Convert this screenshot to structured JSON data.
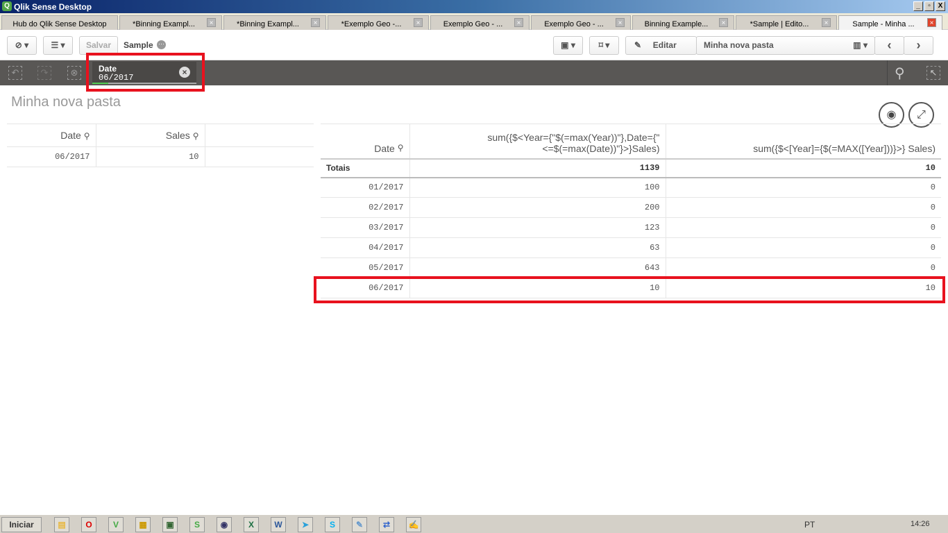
{
  "window": {
    "title": "Qlik Sense Desktop",
    "minimize": "_",
    "restore": "▫",
    "close": "X"
  },
  "tabs": [
    {
      "label": "Hub do Qlik Sense Desktop",
      "closable": false
    },
    {
      "label": "*Binning Exampl...",
      "closable": true
    },
    {
      "label": "*Binning Exampl...",
      "closable": true
    },
    {
      "label": "*Exemplo Geo -...",
      "closable": true
    },
    {
      "label": "Exemplo Geo - ...",
      "closable": true
    },
    {
      "label": "Exemplo Geo - ...",
      "closable": true
    },
    {
      "label": "Binning Example...",
      "closable": true
    },
    {
      "label": "*Sample | Edito...",
      "closable": true
    },
    {
      "label": "Sample - Minha ...",
      "closable": true,
      "active": true
    }
  ],
  "toolbar": {
    "save": "Salvar",
    "app_name": "Sample",
    "edit": "Editar",
    "sheet_name": "Minha nova pasta"
  },
  "selection": {
    "field": "Date",
    "value": "06/2017",
    "progress": 0.15
  },
  "sheet_title": "Minha nova pasta",
  "left_table": {
    "headers": [
      "Date",
      "Sales"
    ],
    "rows": [
      [
        "06/2017",
        "10"
      ]
    ]
  },
  "right_table": {
    "headers": [
      "Date",
      "sum({$<Year={\"$(=max(Year))\"},Date={\"<=$(=max(Date))\"}>}Sales)",
      "sum({$<[Year]={$(=MAX([Year]))}>} Sales)"
    ],
    "totals": [
      "Totais",
      "1139",
      "10"
    ],
    "rows": [
      [
        "01/2017",
        "100",
        "0"
      ],
      [
        "02/2017",
        "200",
        "0"
      ],
      [
        "03/2017",
        "123",
        "0"
      ],
      [
        "04/2017",
        "63",
        "0"
      ],
      [
        "05/2017",
        "643",
        "0"
      ],
      [
        "06/2017",
        "10",
        "10"
      ]
    ]
  },
  "taskbar": {
    "start": "Iniciar",
    "lang": "PT",
    "clock": "14:26"
  },
  "colors": {
    "accent_red": "#e8121e",
    "selection_bar": "#595755",
    "green": "#52cc52"
  }
}
